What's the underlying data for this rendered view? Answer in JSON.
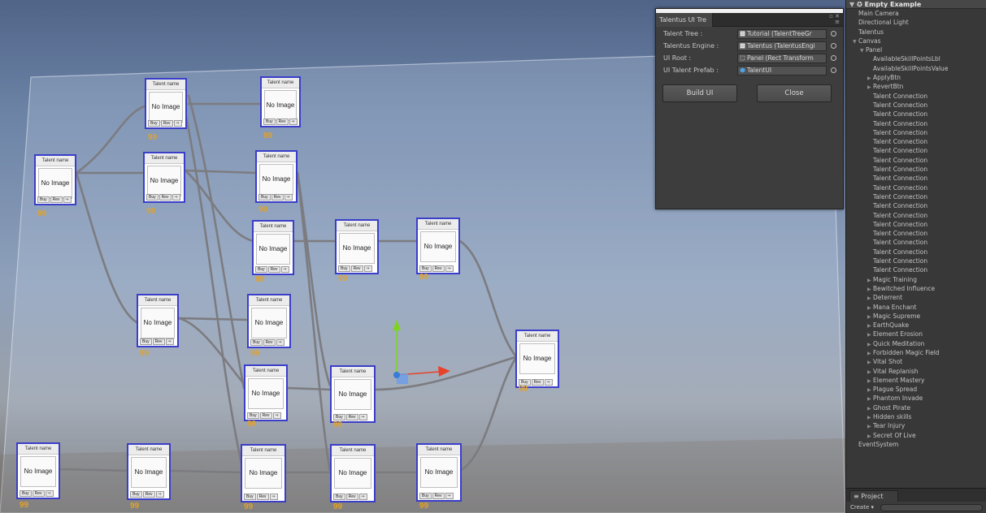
{
  "scene": {
    "nodes": [
      {
        "id": "n1",
        "title": "Talent name",
        "image_text": "No Image",
        "buy": "Buy",
        "rev": "Rev",
        "score": "99"
      },
      {
        "id": "n2",
        "title": "Talent name",
        "image_text": "No Image",
        "buy": "Buy",
        "rev": "Rev",
        "score": "99"
      },
      {
        "id": "n3",
        "title": "Talent name",
        "image_text": "No Image",
        "buy": "Buy",
        "rev": "Rev",
        "score": "99"
      },
      {
        "id": "n4",
        "title": "Talent name",
        "image_text": "No Image",
        "buy": "Buy",
        "rev": "Rev",
        "score": "99"
      },
      {
        "id": "n5",
        "title": "Talent name",
        "image_text": "No Image",
        "buy": "Buy",
        "rev": "Rev",
        "score": "99"
      },
      {
        "id": "n6",
        "title": "Talent name",
        "image_text": "No Image",
        "buy": "Buy",
        "rev": "Rev",
        "score": "99"
      },
      {
        "id": "n7",
        "title": "Talent name",
        "image_text": "No Image",
        "buy": "Buy",
        "rev": "Rev",
        "score": "99"
      },
      {
        "id": "n8",
        "title": "Talent name",
        "image_text": "No Image",
        "buy": "Buy",
        "rev": "Rev",
        "score": "99"
      },
      {
        "id": "n9",
        "title": "Talent name",
        "image_text": "No Image",
        "buy": "Buy",
        "rev": "Rev",
        "score": "99"
      },
      {
        "id": "n10",
        "title": "Talent name",
        "image_text": "No Image",
        "buy": "Buy",
        "rev": "Rev",
        "score": "99"
      },
      {
        "id": "n11",
        "title": "Talent name",
        "image_text": "No Image",
        "buy": "Buy",
        "rev": "Rev",
        "score": "99"
      },
      {
        "id": "n12",
        "title": "Talent name",
        "image_text": "No Image",
        "buy": "Buy",
        "rev": "Rev",
        "score": "99"
      },
      {
        "id": "n13",
        "title": "Talent name",
        "image_text": "No Image",
        "buy": "Buy",
        "rev": "Rev",
        "score": "99"
      },
      {
        "id": "n14",
        "title": "Talent name",
        "image_text": "No Image",
        "buy": "Buy",
        "rev": "Rev",
        "score": "99"
      },
      {
        "id": "n15",
        "title": "Talent name",
        "image_text": "No Image",
        "buy": "Buy",
        "rev": "Rev",
        "score": "99"
      },
      {
        "id": "n16",
        "title": "Talent name",
        "image_text": "No Image",
        "buy": "Buy",
        "rev": "Rev",
        "score": "99"
      },
      {
        "id": "n17",
        "title": "Talent name",
        "image_text": "No Image",
        "buy": "Buy",
        "rev": "Rev",
        "score": "99"
      },
      {
        "id": "n18",
        "title": "Talent name",
        "image_text": "No Image",
        "buy": "Buy",
        "rev": "Rev",
        "score": "99"
      }
    ],
    "gizmo": {
      "y_axis_color": "#7ed321",
      "x_axis_color": "#e8432a",
      "center_color": "#3a7bd5"
    },
    "node_border_color": "#3a3ec8",
    "score_color": "#e3a127"
  },
  "tool_window": {
    "tab_title": "Talentus UI Tre",
    "fields": [
      {
        "label": "Talent Tree :",
        "value": "Tutorial (TalentTreeGr",
        "icon": "script-icon"
      },
      {
        "label": "Talentus Engine :",
        "value": "Talentus (TalentusEngi",
        "icon": "script-icon"
      },
      {
        "label": "UI Root :",
        "value": "Panel (Rect Transform",
        "icon": "rect-transform-icon"
      },
      {
        "label": "UI Talent Prefab :",
        "value": "TalentUI",
        "icon": "prefab-icon"
      }
    ],
    "build_button": "Build UI",
    "close_button": "Close"
  },
  "hierarchy": {
    "scene_name": "Empty Example",
    "items": [
      {
        "label": "Main Camera",
        "level": 1,
        "expand": ""
      },
      {
        "label": "Directional Light",
        "level": 1,
        "expand": ""
      },
      {
        "label": "Talentus",
        "level": 1,
        "expand": ""
      },
      {
        "label": "Canvas",
        "level": 1,
        "expand": "▼"
      },
      {
        "label": "Panel",
        "level": 2,
        "expand": "▼"
      },
      {
        "label": "AvailableSkillPointsLbl",
        "level": 3,
        "expand": ""
      },
      {
        "label": "AvailableSkillPointsValue",
        "level": 3,
        "expand": ""
      },
      {
        "label": "ApplyBtn",
        "level": 3,
        "expand": "▶"
      },
      {
        "label": "RevertBtn",
        "level": 3,
        "expand": "▶"
      },
      {
        "label": "Talent Connection",
        "level": 3,
        "expand": ""
      },
      {
        "label": "Talent Connection",
        "level": 3,
        "expand": ""
      },
      {
        "label": "Talent Connection",
        "level": 3,
        "expand": ""
      },
      {
        "label": "Talent Connection",
        "level": 3,
        "expand": ""
      },
      {
        "label": "Talent Connection",
        "level": 3,
        "expand": ""
      },
      {
        "label": "Talent Connection",
        "level": 3,
        "expand": ""
      },
      {
        "label": "Talent Connection",
        "level": 3,
        "expand": ""
      },
      {
        "label": "Talent Connection",
        "level": 3,
        "expand": ""
      },
      {
        "label": "Talent Connection",
        "level": 3,
        "expand": ""
      },
      {
        "label": "Talent Connection",
        "level": 3,
        "expand": ""
      },
      {
        "label": "Talent Connection",
        "level": 3,
        "expand": ""
      },
      {
        "label": "Talent Connection",
        "level": 3,
        "expand": ""
      },
      {
        "label": "Talent Connection",
        "level": 3,
        "expand": ""
      },
      {
        "label": "Talent Connection",
        "level": 3,
        "expand": ""
      },
      {
        "label": "Talent Connection",
        "level": 3,
        "expand": ""
      },
      {
        "label": "Talent Connection",
        "level": 3,
        "expand": ""
      },
      {
        "label": "Talent Connection",
        "level": 3,
        "expand": ""
      },
      {
        "label": "Talent Connection",
        "level": 3,
        "expand": ""
      },
      {
        "label": "Talent Connection",
        "level": 3,
        "expand": ""
      },
      {
        "label": "Talent Connection",
        "level": 3,
        "expand": ""
      },
      {
        "label": "Magic Training",
        "level": 3,
        "expand": "▶"
      },
      {
        "label": "Bewitched Influence",
        "level": 3,
        "expand": "▶"
      },
      {
        "label": "Deterrent",
        "level": 3,
        "expand": "▶"
      },
      {
        "label": "Mana Enchant",
        "level": 3,
        "expand": "▶"
      },
      {
        "label": "Magic Supreme",
        "level": 3,
        "expand": "▶"
      },
      {
        "label": "EarthQuake",
        "level": 3,
        "expand": "▶"
      },
      {
        "label": "Element Erosion",
        "level": 3,
        "expand": "▶"
      },
      {
        "label": "Quick Meditation",
        "level": 3,
        "expand": "▶"
      },
      {
        "label": "Forbidden Magic Field",
        "level": 3,
        "expand": "▶"
      },
      {
        "label": "Vital Shot",
        "level": 3,
        "expand": "▶"
      },
      {
        "label": "Vital Replanish",
        "level": 3,
        "expand": "▶"
      },
      {
        "label": "Element Mastery",
        "level": 3,
        "expand": "▶"
      },
      {
        "label": "Plague Spread",
        "level": 3,
        "expand": "▶"
      },
      {
        "label": "Phantom Invade",
        "level": 3,
        "expand": "▶"
      },
      {
        "label": "Ghost Pirate",
        "level": 3,
        "expand": "▶"
      },
      {
        "label": "Hidden skills",
        "level": 3,
        "expand": "▶"
      },
      {
        "label": "Tear Injury",
        "level": 3,
        "expand": "▶"
      },
      {
        "label": "Secret Of Live",
        "level": 3,
        "expand": "▶"
      },
      {
        "label": "EventSystem",
        "level": 1,
        "expand": ""
      }
    ]
  },
  "project": {
    "tab_label": "Project",
    "create_label": "Create"
  }
}
